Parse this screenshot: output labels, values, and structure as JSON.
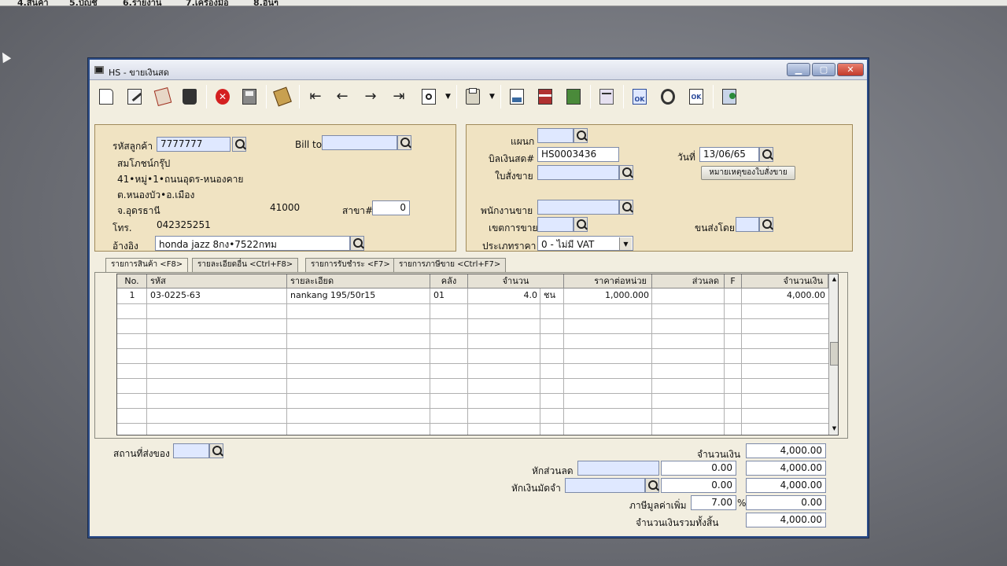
{
  "menubar": {
    "items": [
      "4.สินค้า",
      "5.บัญชี",
      "6.รายงาน",
      "7.เครื่องมือ",
      "8.อื่นๆ"
    ]
  },
  "window": {
    "title": "HS - ขายเงินสด"
  },
  "toolbar": {
    "icons": [
      "new-icon",
      "edit-icon",
      "copy-icon",
      "delete-icon",
      "cancel-icon",
      "save-icon",
      "transfer-icon",
      "first-record-icon",
      "previous-record-icon",
      "next-record-icon",
      "last-record-icon",
      "search-record-icon",
      "print-icon",
      "calculator-icon",
      "card-icon",
      "report-icon",
      "export-icon",
      "approve-icon",
      "tools-icon",
      "ok-icon",
      "settings-icon"
    ]
  },
  "customer": {
    "code_label": "รหัสลูกค้า",
    "code_value": "7777777",
    "bill_to_label": "Bill to",
    "bill_to_value": "",
    "name": "สมโภชน์กรุ๊ป",
    "addr1": "41•หมู่•1•ถนนอุดร-หนองคาย",
    "addr2": "ต.หนองบัว•อ.เมือง",
    "addr3": "จ.อุดรธานี",
    "zip": "41000",
    "branch_label": "สาขา#",
    "branch_value": "0",
    "phone_label": "โทร.",
    "phone_value": "042325251",
    "ref_label": "อ้างอิง",
    "ref_value": "honda jazz 8กง•7522กทม"
  },
  "doc": {
    "dept_label": "แผนก",
    "dept_value": "",
    "cashbill_label": "บิลเงินสด#",
    "cashbill_value": "HS0003436",
    "date_label": "วันที่",
    "date_value": "13/06/65",
    "order_label": "ใบสั่งขาย",
    "order_value": "",
    "note_button": "หมายเหตุของใบสั่งขาย",
    "salesperson_label": "พนักงานขาย",
    "salesperson_value": "",
    "area_label": "เขตการขาย",
    "area_value": "",
    "ship_label": "ขนส่งโดย",
    "ship_value": "",
    "pricetype_label": "ประเภทราคา",
    "pricetype_value": "0 - ไม่มี VAT"
  },
  "tabs": [
    "รายการสินค้า <F8>",
    "รายละเอียดอื่น <Ctrl+F8>",
    "รายการรับชำระ <F7>",
    "รายการภาษีขาย <Ctrl+F7>"
  ],
  "grid": {
    "headers": [
      "No.",
      "รหัส",
      "รายละเอียด",
      "คลัง",
      "จำนวน",
      "ราคาต่อหน่วย",
      "ส่วนลด",
      "F",
      "จำนวนเงิน"
    ],
    "rows": [
      {
        "no": "1",
        "code": "03-0225-63",
        "desc": "nankang 195/50r15",
        "wh": "01",
        "qty": "4.0",
        "unit": "ชน",
        "price": "1,000.000",
        "disc": "",
        "f": "",
        "amount": "4,000.00"
      }
    ]
  },
  "totals": {
    "ship_place_label": "สถานที่ส่งของ",
    "ship_place_value": "",
    "amount_label": "จำนวนเงิน",
    "amount_value": "4,000.00",
    "discount_label": "หักส่วนลด",
    "discount_input": "",
    "discount_value": "0.00",
    "discount_net": "4,000.00",
    "deposit_label": "หักเงินมัดจำ",
    "deposit_input": "",
    "deposit_value": "0.00",
    "deposit_net": "4,000.00",
    "vat_label": "ภาษีมูลค่าเพิ่ม",
    "vat_rate": "7.00",
    "vat_pct": "%",
    "vat_value": "0.00",
    "grand_label": "จำนวนเงินรวมทั้งสิ้น",
    "grand_value": "4,000.00"
  }
}
